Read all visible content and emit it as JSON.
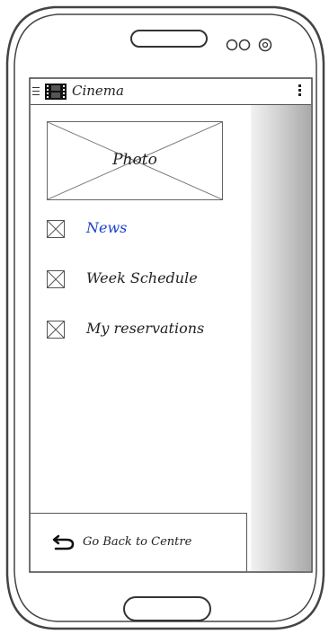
{
  "app_bar": {
    "title": "Cinema"
  },
  "drawer": {
    "photo_label": "Photo",
    "items": [
      {
        "label": "News",
        "active": true
      },
      {
        "label": "Week Schedule",
        "active": false
      },
      {
        "label": "My reservations",
        "active": false
      }
    ],
    "footer": {
      "label": "Go Back to Centre"
    }
  },
  "colors": {
    "active_text": "#1a3fd0",
    "text": "#222222"
  }
}
